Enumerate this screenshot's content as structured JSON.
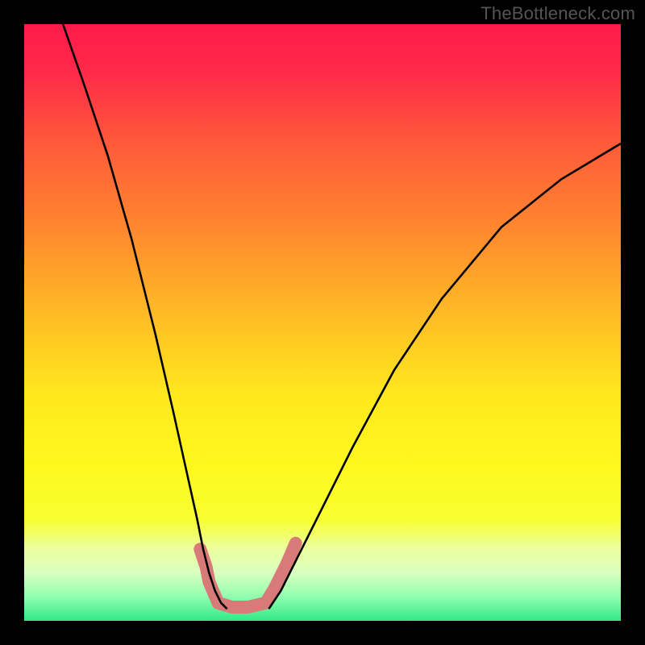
{
  "watermark": "TheBottleneck.com",
  "chart_data": {
    "type": "line",
    "title": "",
    "xlabel": "",
    "ylabel": "",
    "xlim": [
      0,
      100
    ],
    "ylim": [
      0,
      100
    ],
    "background_gradient_stops": [
      {
        "offset": 0.0,
        "color": "#ff1a4b"
      },
      {
        "offset": 0.08,
        "color": "#ff2a49"
      },
      {
        "offset": 0.2,
        "color": "#ff5a3a"
      },
      {
        "offset": 0.35,
        "color": "#ff8a2e"
      },
      {
        "offset": 0.5,
        "color": "#ffc024"
      },
      {
        "offset": 0.62,
        "color": "#ffe81e"
      },
      {
        "offset": 0.74,
        "color": "#fff81e"
      },
      {
        "offset": 0.83,
        "color": "#f7ff30"
      },
      {
        "offset": 0.88,
        "color": "#ecffa0"
      },
      {
        "offset": 0.92,
        "color": "#d8ffc0"
      },
      {
        "offset": 0.96,
        "color": "#90ffb0"
      },
      {
        "offset": 1.0,
        "color": "#30e886"
      }
    ],
    "series": [
      {
        "name": "left-branch",
        "color": "#000000",
        "x": [
          6.5,
          10,
          14,
          18,
          22,
          25,
          27,
          29,
          30,
          31,
          32,
          33,
          34
        ],
        "y": [
          100,
          90,
          78,
          64,
          48,
          35,
          26,
          17,
          12,
          8,
          5,
          3,
          2
        ]
      },
      {
        "name": "right-branch",
        "color": "#000000",
        "x": [
          41,
          43,
          46,
          50,
          55,
          62,
          70,
          80,
          90,
          100
        ],
        "y": [
          2,
          5,
          11,
          19,
          29,
          42,
          54,
          66,
          74,
          80
        ]
      },
      {
        "name": "valley-highlight",
        "color": "#d87b78",
        "x": [
          29.5,
          30.5,
          31,
          32.5,
          34.8,
          37.5,
          40.5,
          42,
          44.0,
          45.5
        ],
        "y": [
          12,
          9,
          6.5,
          3,
          2.3,
          2.3,
          3,
          5.5,
          9.5,
          13
        ]
      }
    ],
    "annotations": []
  }
}
